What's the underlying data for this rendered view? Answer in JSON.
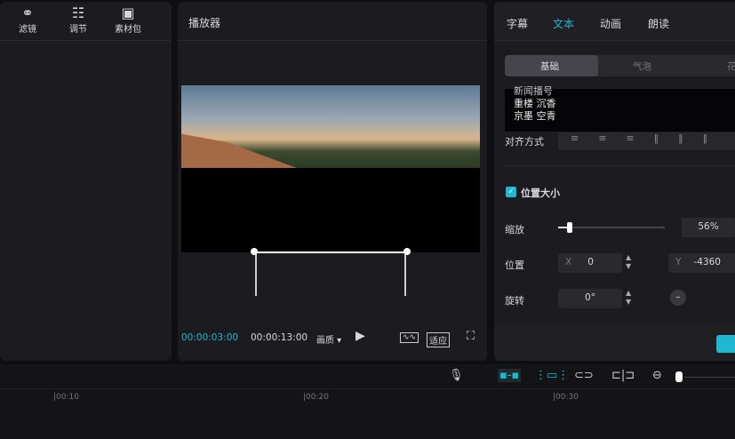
{
  "left_toolbar": [
    {
      "label": "滤镜",
      "icon": "filter-icon"
    },
    {
      "label": "调节",
      "icon": "sliders-icon"
    },
    {
      "label": "素材包",
      "icon": "package-icon"
    }
  ],
  "player": {
    "title": "播放器",
    "current_time": "00:00:03:00",
    "total_time": "00:00:13:00",
    "quality": "画质",
    "fit_label": "适应"
  },
  "right": {
    "tabs": [
      "字幕",
      "文本",
      "动画",
      "朗读"
    ],
    "active_tab": "文本",
    "subtabs": [
      "基础",
      "气泡",
      "花"
    ],
    "text_lines": [
      "新闻播号",
      "重楼 沉香",
      "京墨 空青"
    ],
    "align_label": "对齐方式",
    "section": "位置大小",
    "scale_label": "缩放",
    "scale_value": "56%",
    "scale_fraction": 0.56,
    "position_label": "位置",
    "x_label": "X",
    "x_value": "0",
    "y_label": "Y",
    "y_value": "-4360",
    "rotate_label": "旋转",
    "rotate_value": "0°",
    "accent": "#1fb8d0"
  },
  "timeline": {
    "ruler": [
      "|00:10",
      "|00:20",
      "|00:30"
    ]
  }
}
